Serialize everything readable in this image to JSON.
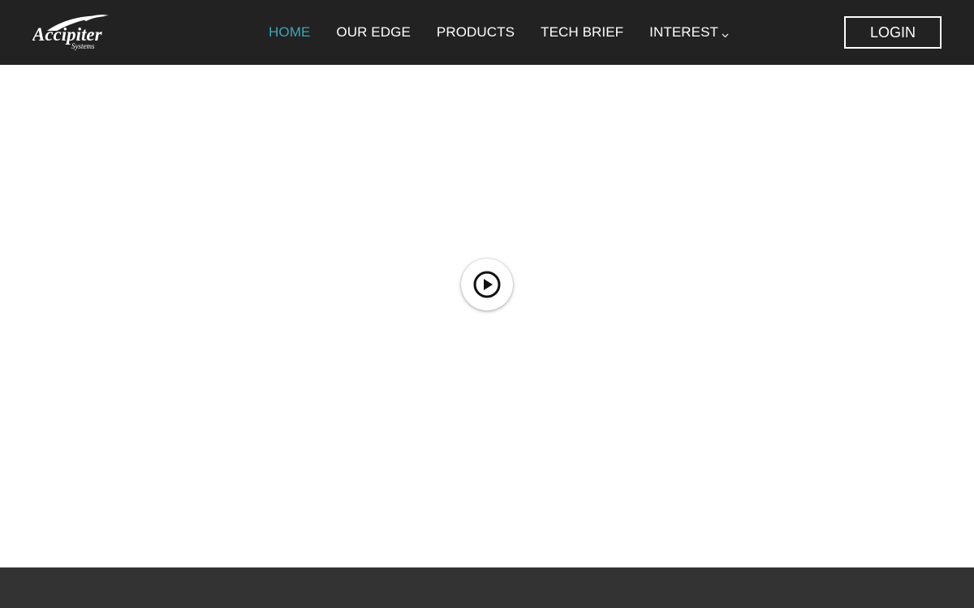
{
  "brand": {
    "logo_icon": "accipiter-systems-logo",
    "logo_text": "Accipiter",
    "logo_subtext": "Systems"
  },
  "nav": {
    "items": [
      {
        "label": "HOME",
        "active": true
      },
      {
        "label": "OUR EDGE",
        "active": false
      },
      {
        "label": "PRODUCTS",
        "active": false
      },
      {
        "label": "TECH BRIEF",
        "active": false
      },
      {
        "label": "INTEREST",
        "active": false,
        "icon": "chevron-down-icon"
      }
    ]
  },
  "header": {
    "login_label": "LOGIN"
  },
  "hero": {
    "play_icon": "play-circle-icon"
  },
  "colors": {
    "navbar_bg": "#222222",
    "accent": "#3fa5bb",
    "nav_text": "#ffffff",
    "footer_bg": "#333333",
    "page_bg": "#ffffff"
  }
}
